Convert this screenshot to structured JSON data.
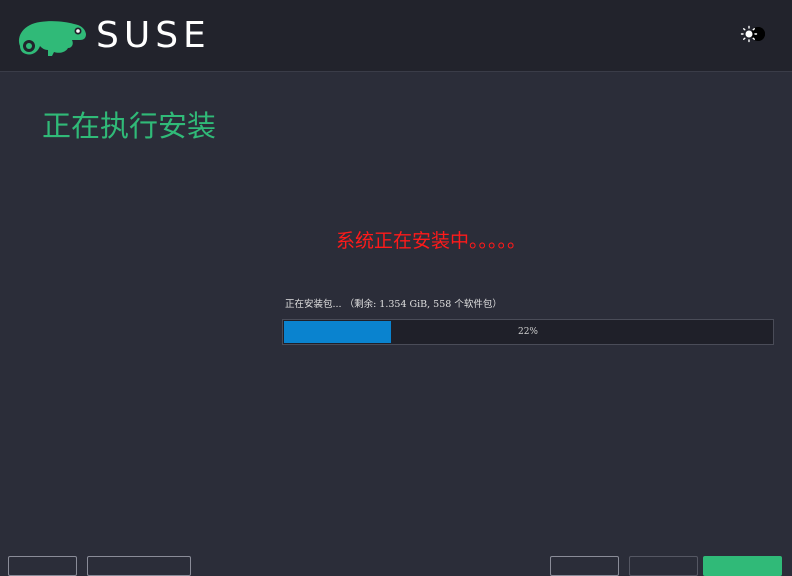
{
  "header": {
    "brand": "SUSE",
    "logo_icon": "chameleon-logo-icon",
    "theme_toggle_icon": "sun-moon-toggle-icon"
  },
  "main": {
    "title": "正在执行安装",
    "status_message": "系统正在安装中。。。。。",
    "progress": {
      "label": "正在安装包... （剩余: 1.354 GiB, 558 个软件包）",
      "percent_text": "22%",
      "value": 0.22
    }
  },
  "footer": {
    "buttons": [
      "",
      "",
      "",
      "",
      ""
    ]
  },
  "colors": {
    "accent": "#30ba78",
    "progress_fill": "#0a83cf",
    "status_red": "#ff1a1a",
    "background": "#2b2d39",
    "header_bg": "#22232c"
  }
}
